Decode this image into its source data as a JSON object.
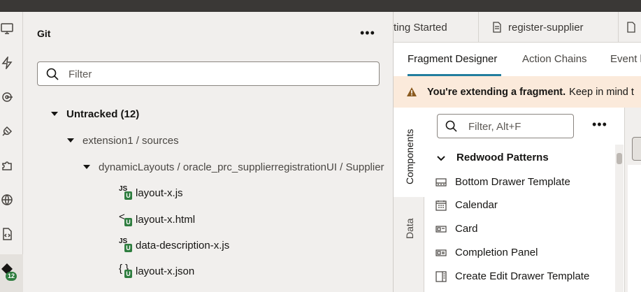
{
  "activity_bar": {
    "icons": [
      "desktop-icon",
      "lightning-icon",
      "target-icon",
      "plug-icon",
      "puzzle-icon",
      "globe-icon",
      "code-file-icon",
      "git-icon"
    ],
    "git_badge": "12"
  },
  "git_panel": {
    "title": "Git",
    "more_label": "•••",
    "filter_placeholder": "Filter",
    "untracked_label": "Untracked (12)",
    "folder1": "extension1 / sources",
    "folder2": "dynamicLayouts / oracle_prc_supplierregistrationUI / Supplier",
    "files": [
      {
        "name": "layout-x.js",
        "type_glyph": "JS",
        "status": "U"
      },
      {
        "name": "layout-x.html",
        "type_glyph": "<",
        "status": "U"
      },
      {
        "name": "data-description-x.js",
        "type_glyph": "JS",
        "status": "U"
      },
      {
        "name": "layout-x.json",
        "type_glyph": "{ }",
        "status": "U"
      }
    ]
  },
  "editor_tabs": [
    {
      "label": "ting Started"
    },
    {
      "label": "register-supplier",
      "icon": "document-icon"
    }
  ],
  "sub_tabs": {
    "fragment_designer": "Fragment Designer",
    "action_chains": "Action Chains",
    "event": "Event l"
  },
  "banner": {
    "bold": "You're extending a fragment.",
    "text": "Keep in mind t"
  },
  "vertical_tabs": {
    "components": "Components",
    "data": "Data"
  },
  "components": {
    "filter_placeholder": "Filter, Alt+F",
    "more_label": "•••",
    "section": "Redwood Patterns",
    "items": [
      {
        "label": "Bottom Drawer Template",
        "icon": "drawer-icon"
      },
      {
        "label": "Calendar",
        "icon": "calendar-icon"
      },
      {
        "label": "Card",
        "icon": "card-icon"
      },
      {
        "label": "Completion Panel",
        "icon": "panel-icon"
      },
      {
        "label": "Create Edit Drawer Template",
        "icon": "drawer-template-icon"
      }
    ]
  },
  "colors": {
    "accent": "#227e9e",
    "git_badge": "#2f7d3f",
    "banner_bg": "#fbeadb",
    "warning": "#8a5a1f"
  }
}
